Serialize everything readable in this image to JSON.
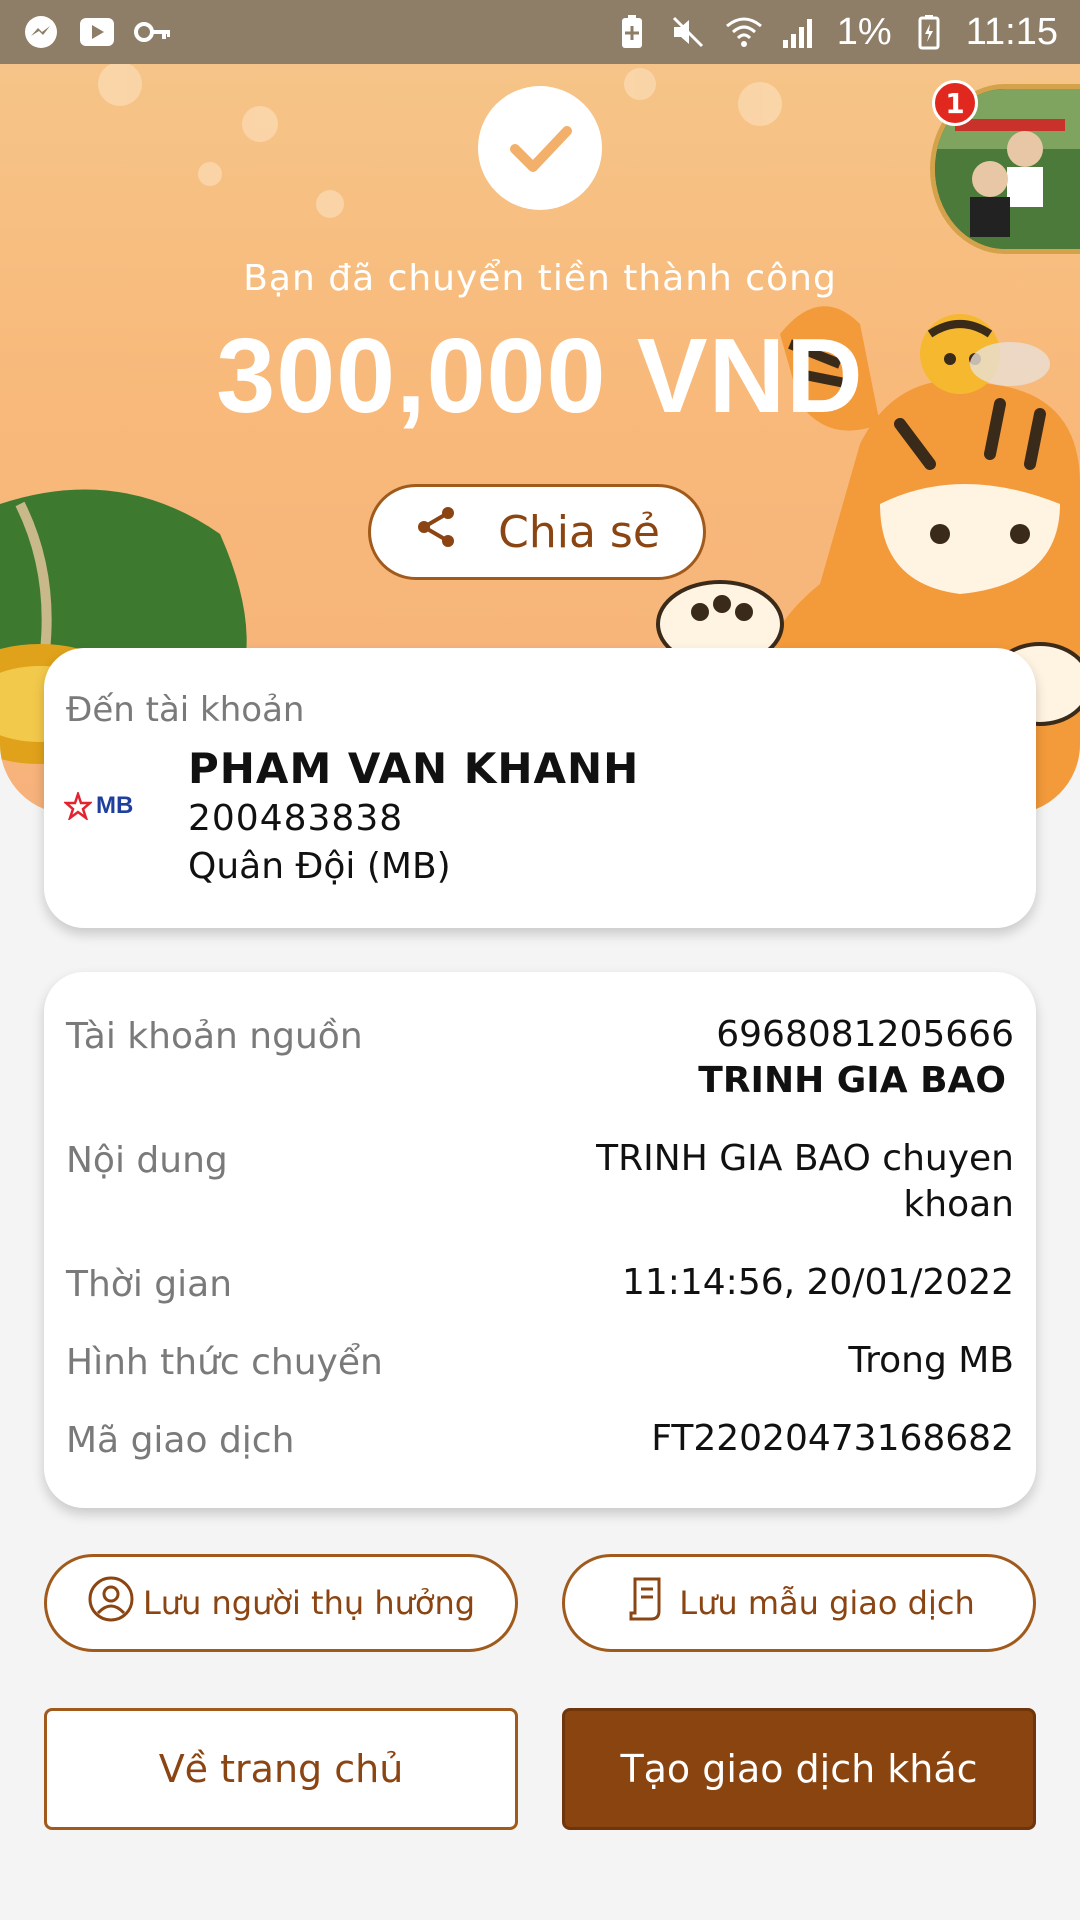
{
  "status_bar": {
    "battery": "1%",
    "time": "11:15",
    "icons": [
      "messenger-icon",
      "video-icon",
      "key-icon",
      "battery-saver-icon",
      "mute-icon",
      "wifi-icon",
      "signal-icon",
      "battery-icon"
    ]
  },
  "hero": {
    "success_message": "Bạn đã chuyển tiền thành công",
    "amount": "300,000 VND",
    "share_label": "Chia sẻ",
    "notification_count": "1"
  },
  "destination": {
    "label": "Đến tài khoản",
    "name": "PHAM VAN KHANH",
    "account_number": "200483838",
    "bank_name": "Quân Đội (MB)",
    "bank_logo_text": "MB"
  },
  "details": {
    "source_label": "Tài khoản nguồn",
    "source_account": "6968081205666",
    "source_name": "TRINH GIA BAO",
    "content_label": "Nội dung",
    "content_line1": "TRINH GIA BAO chuyen",
    "content_line2": "khoan",
    "time_label": "Thời gian",
    "time_value": "11:14:56, 20/01/2022",
    "method_label": "Hình thức chuyển",
    "method_value": "Trong MB",
    "txn_label": "Mã giao dịch",
    "txn_value": "FT22020473168682"
  },
  "actions": {
    "save_beneficiary": "Lưu người thụ hưởng",
    "save_template": "Lưu mẫu giao dịch",
    "home": "Về trang chủ",
    "new_transaction": "Tạo giao dịch khác"
  },
  "colors": {
    "accent": "#8a4410",
    "status_bar": "#8f7e67",
    "hero_bg": "#f6c488"
  }
}
